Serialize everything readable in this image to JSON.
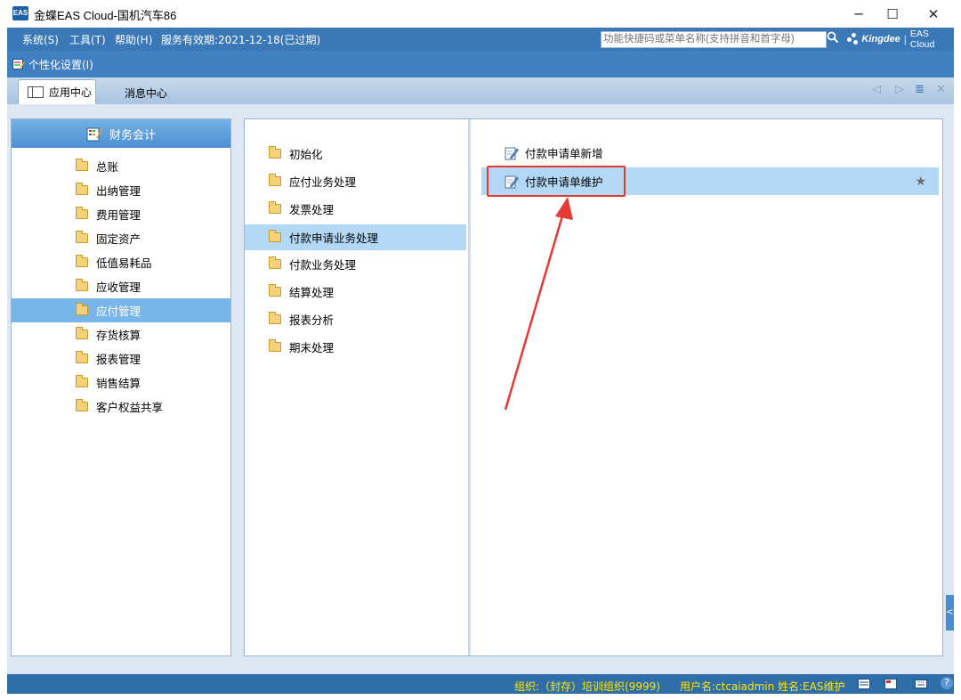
{
  "window": {
    "app_icon_text": "EAS",
    "title": "金蝶EAS Cloud-国机汽车86",
    "buttons": {
      "minimize": "─",
      "maximize": "☐",
      "close": "✕"
    }
  },
  "menubar": {
    "items": [
      "系统(S)",
      "工具(T)",
      "帮助(H)"
    ],
    "service_validity": "服务有效期:2021-12-18(已过期)",
    "search_placeholder": "功能快捷码或菜单名称(支持拼音和首字母)",
    "brand_name": "Kingdee",
    "brand_product": "EAS Cloud"
  },
  "toolbar": {
    "personalize_label": "个性化设置(I)"
  },
  "tabs": {
    "app_center": "应用中心",
    "message_center": "消息中心",
    "controls": {
      "prev": "◁",
      "next": "▷",
      "list": "≣",
      "close": "✕"
    }
  },
  "module_panel": {
    "header": "财务会计",
    "items": [
      "总账",
      "出纳管理",
      "费用管理",
      "固定资产",
      "低值易耗品",
      "应收管理",
      "应付管理",
      "存货核算",
      "报表管理",
      "销售结算",
      "客户权益共享"
    ],
    "selected": "应付管理"
  },
  "category_panel": {
    "items": [
      "初始化",
      "应付业务处理",
      "发票处理",
      "付款申请业务处理",
      "付款业务处理",
      "结算处理",
      "报表分析",
      "期末处理"
    ],
    "selected": "付款申请业务处理"
  },
  "function_panel": {
    "items": [
      "付款申请单新增",
      "付款申请单维护"
    ],
    "selected": "付款申请单维护",
    "favorite_icon": "★"
  },
  "statusbar": {
    "org": "组织:（封存）培训组织(9999)",
    "user": "用户名:ctcaiadmin  姓名:EAS维护",
    "help": "?"
  },
  "side_handle": "<",
  "colors": {
    "menubar": "#3a78b8",
    "toolbar": "#3f80c2",
    "header": "#4d90d3",
    "selection": "#78b6e9",
    "selection_light": "#b3d8f5",
    "status_text": "#ffe600",
    "callout": "#e53935"
  }
}
